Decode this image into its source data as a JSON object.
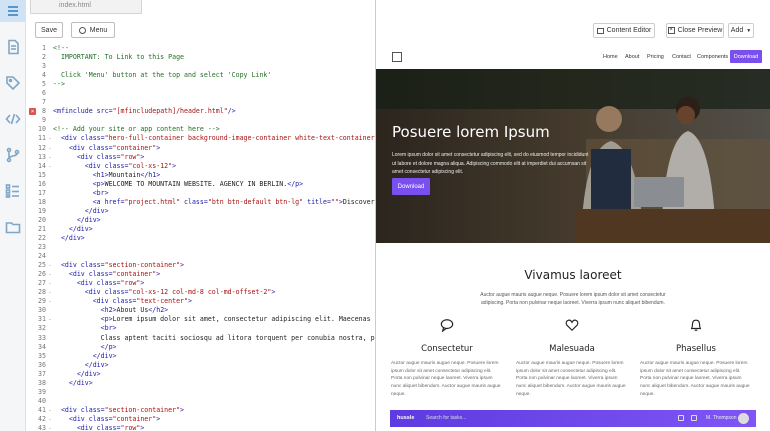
{
  "editor": {
    "file_tab": "index.html",
    "save_label": "Save",
    "menu_label": "Menu",
    "lines": [
      {
        "n": "1",
        "fold": "",
        "err": false,
        "parts": [
          [
            "c-com",
            "<!--"
          ]
        ]
      },
      {
        "n": "2",
        "fold": "",
        "err": false,
        "parts": [
          [
            "c-com",
            "  IMPORTANT: To Link to this Page"
          ]
        ]
      },
      {
        "n": "3",
        "fold": "",
        "err": false,
        "parts": [
          [
            "c-com",
            ""
          ]
        ]
      },
      {
        "n": "4",
        "fold": "",
        "err": false,
        "parts": [
          [
            "c-com",
            "  Click 'Menu' button at the top and select 'Copy Link'"
          ]
        ]
      },
      {
        "n": "5",
        "fold": "",
        "err": false,
        "parts": [
          [
            "c-com",
            "-->"
          ]
        ]
      },
      {
        "n": "6",
        "fold": "",
        "err": false,
        "parts": []
      },
      {
        "n": "7",
        "fold": "",
        "err": false,
        "parts": []
      },
      {
        "n": "8",
        "fold": "",
        "err": true,
        "parts": [
          [
            "c-tag",
            "<mfinclude "
          ],
          [
            "c-tag",
            "src="
          ],
          [
            "c-str",
            "\"[mfincludepath]/header.html\""
          ],
          [
            "c-tag",
            "/>"
          ]
        ]
      },
      {
        "n": "9",
        "fold": "",
        "err": false,
        "parts": []
      },
      {
        "n": "10",
        "fold": "",
        "err": false,
        "parts": [
          [
            "c-com",
            "<!-- Add your site or app content here -->"
          ]
        ]
      },
      {
        "n": "11",
        "fold": "-",
        "err": false,
        "parts": [
          [
            "c-tag",
            "  <div class="
          ],
          [
            "c-str",
            "\"hero-full-container background-image-container white-text-container\""
          ],
          [
            "c-tag",
            ">"
          ]
        ]
      },
      {
        "n": "12",
        "fold": "-",
        "err": false,
        "parts": [
          [
            "c-tag",
            "    <div class="
          ],
          [
            "c-str",
            "\"container\""
          ],
          [
            "c-tag",
            ">"
          ]
        ]
      },
      {
        "n": "13",
        "fold": "-",
        "err": false,
        "parts": [
          [
            "c-tag",
            "      <div class="
          ],
          [
            "c-str",
            "\"row\""
          ],
          [
            "c-tag",
            ">"
          ]
        ]
      },
      {
        "n": "14",
        "fold": "-",
        "err": false,
        "parts": [
          [
            "c-tag",
            "        <div class="
          ],
          [
            "c-str",
            "\"col-xs-12\""
          ],
          [
            "c-tag",
            ">"
          ]
        ]
      },
      {
        "n": "15",
        "fold": "",
        "err": false,
        "parts": [
          [
            "c-tag",
            "          <h1>"
          ],
          [
            "c-txt",
            "Mountain"
          ],
          [
            "c-tag",
            "</h1>"
          ]
        ]
      },
      {
        "n": "16",
        "fold": "",
        "err": false,
        "parts": [
          [
            "c-tag",
            "          <p>"
          ],
          [
            "c-txt",
            "WELCOME TO MOUNTAIN WEBSITE. AGENCY IN BERLIN."
          ],
          [
            "c-tag",
            "</p>"
          ]
        ]
      },
      {
        "n": "17",
        "fold": "",
        "err": false,
        "parts": [
          [
            "c-tag",
            "          <br>"
          ]
        ]
      },
      {
        "n": "18",
        "fold": "",
        "err": false,
        "parts": [
          [
            "c-tag",
            "          <a href="
          ],
          [
            "c-str",
            "\"project.html\""
          ],
          [
            "c-tag",
            " class="
          ],
          [
            "c-str",
            "\"btn btn-default btn-lg\""
          ],
          [
            "c-tag",
            " title="
          ],
          [
            "c-str",
            "\"\""
          ],
          [
            "c-tag",
            ">"
          ],
          [
            "c-txt",
            "Discover"
          ]
        ]
      },
      {
        "n": "19",
        "fold": "",
        "err": false,
        "parts": [
          [
            "c-tag",
            "        </div>"
          ]
        ]
      },
      {
        "n": "20",
        "fold": "",
        "err": false,
        "parts": [
          [
            "c-tag",
            "      </div>"
          ]
        ]
      },
      {
        "n": "21",
        "fold": "",
        "err": false,
        "parts": [
          [
            "c-tag",
            "    </div>"
          ]
        ]
      },
      {
        "n": "22",
        "fold": "",
        "err": false,
        "parts": [
          [
            "c-tag",
            "  </div>"
          ]
        ]
      },
      {
        "n": "23",
        "fold": "",
        "err": false,
        "parts": []
      },
      {
        "n": "24",
        "fold": "",
        "err": false,
        "parts": []
      },
      {
        "n": "25",
        "fold": "-",
        "err": false,
        "parts": [
          [
            "c-tag",
            "  <div class="
          ],
          [
            "c-str",
            "\"section-container\""
          ],
          [
            "c-tag",
            ">"
          ]
        ]
      },
      {
        "n": "26",
        "fold": "-",
        "err": false,
        "parts": [
          [
            "c-tag",
            "    <div class="
          ],
          [
            "c-str",
            "\"container\""
          ],
          [
            "c-tag",
            ">"
          ]
        ]
      },
      {
        "n": "27",
        "fold": "-",
        "err": false,
        "parts": [
          [
            "c-tag",
            "      <div class="
          ],
          [
            "c-str",
            "\"row\""
          ],
          [
            "c-tag",
            ">"
          ]
        ]
      },
      {
        "n": "28",
        "fold": "-",
        "err": false,
        "parts": [
          [
            "c-tag",
            "        <div class="
          ],
          [
            "c-str",
            "\"col-xs-12 col-md-8 col-md-offset-2\""
          ],
          [
            "c-tag",
            ">"
          ]
        ]
      },
      {
        "n": "29",
        "fold": "-",
        "err": false,
        "parts": [
          [
            "c-tag",
            "          <div class="
          ],
          [
            "c-str",
            "\"text-center\""
          ],
          [
            "c-tag",
            ">"
          ]
        ]
      },
      {
        "n": "30",
        "fold": "",
        "err": false,
        "parts": [
          [
            "c-tag",
            "            <h2>"
          ],
          [
            "c-txt",
            "About Us"
          ],
          [
            "c-tag",
            "</h2>"
          ]
        ]
      },
      {
        "n": "31",
        "fold": "-",
        "err": false,
        "parts": [
          [
            "c-tag",
            "            <p>"
          ],
          [
            "c-txt",
            "Lorem ipsum dolor sit amet, consectetur adipiscing elit. Maecenas luctus"
          ]
        ]
      },
      {
        "n": "32",
        "fold": "",
        "err": false,
        "parts": [
          [
            "c-tag",
            "            <br>"
          ]
        ]
      },
      {
        "n": "33",
        "fold": "",
        "err": false,
        "parts": [
          [
            "c-txt",
            "            Class aptent taciti sociosqu ad litora torquent per conubia nostra, per inc"
          ]
        ]
      },
      {
        "n": "34",
        "fold": "",
        "err": false,
        "parts": [
          [
            "c-tag",
            "            </p>"
          ]
        ]
      },
      {
        "n": "35",
        "fold": "",
        "err": false,
        "parts": [
          [
            "c-tag",
            "          </div>"
          ]
        ]
      },
      {
        "n": "36",
        "fold": "",
        "err": false,
        "parts": [
          [
            "c-tag",
            "        </div>"
          ]
        ]
      },
      {
        "n": "37",
        "fold": "",
        "err": false,
        "parts": [
          [
            "c-tag",
            "      </div>"
          ]
        ]
      },
      {
        "n": "38",
        "fold": "",
        "err": false,
        "parts": [
          [
            "c-tag",
            "    </div>"
          ]
        ]
      },
      {
        "n": "39",
        "fold": "",
        "err": false,
        "parts": []
      },
      {
        "n": "40",
        "fold": "",
        "err": false,
        "parts": []
      },
      {
        "n": "41",
        "fold": "-",
        "err": false,
        "parts": [
          [
            "c-tag",
            "  <div class="
          ],
          [
            "c-str",
            "\"section-container\""
          ],
          [
            "c-tag",
            ">"
          ]
        ]
      },
      {
        "n": "42",
        "fold": "-",
        "err": false,
        "parts": [
          [
            "c-tag",
            "    <div class="
          ],
          [
            "c-str",
            "\"container\""
          ],
          [
            "c-tag",
            ">"
          ]
        ]
      },
      {
        "n": "43",
        "fold": "-",
        "err": false,
        "parts": [
          [
            "c-tag",
            "      <div class="
          ],
          [
            "c-str",
            "\"row\""
          ],
          [
            "c-tag",
            ">"
          ]
        ]
      },
      {
        "n": "44",
        "fold": "-",
        "err": false,
        "parts": [
          [
            "c-tag",
            "        <div class="
          ],
          [
            "c-str",
            "\"col-xs-12\""
          ],
          [
            "c-tag",
            ">"
          ]
        ]
      }
    ]
  },
  "preview": {
    "content_editor_label": "Content Editor",
    "close_preview_label": "Close Preview",
    "add_label": "Add",
    "nav": {
      "links": [
        "Home",
        "About",
        "Pricing",
        "Contact",
        "Components"
      ],
      "download": "Download"
    },
    "hero": {
      "title": "Posuere lorem Ipsum",
      "text": "Lorem ipsum dolor sit amet consectetur adipiscing elit, sed do eiusmod tempor incididunt ut labore et dolore magna aliqua. Adipiscing commodo elit at imperdiet dui accumsan sit amet consectetur adipiscing elit.",
      "button": "Download"
    },
    "section": {
      "title": "Vivamus laoreet",
      "subtitle": "Auctor augue mauris augue neque. Posuere lorem ipsum dolor sit amet consectetur adipiscing. Porta non pulvinar neque laoreet. Viverra ipsum nunc aliquet bibendum."
    },
    "features": [
      {
        "icon": "chat-bubble-icon",
        "title": "Consectetur",
        "text": "Auctor augue mauris augue neque. Posuere lorem ipsum dolor sit amet consectetur adipiscing elit. Porta non pulvinar neque laoreet. Viverra ipsum nunc aliquet bibendum. Auctor augue mauris augue neque."
      },
      {
        "icon": "heart-icon",
        "title": "Malesuada",
        "text": "Auctor augue mauris augue neque. Posuere lorem ipsum dolor sit amet consectetur adipiscing elit. Porta non pulvinar neque laoreet. Viverra ipsum nunc aliquet bibendum. Auctor augue mauris augue neque."
      },
      {
        "icon": "bell-icon",
        "title": "Phasellus",
        "text": "Auctor augue mauris augue neque. Posuere lorem ipsum dolor sit amet consectetur adipiscing elit. Porta non pulvinar neque laoreet. Viverra ipsum nunc aliquet bibendum. Auctor augue mauris augue neque."
      }
    ],
    "bottom_bar": {
      "logo": "hussle",
      "search": "Search for tasks...",
      "user": "M. Thompson"
    }
  },
  "colors": {
    "accent": "#7a4ff0",
    "rail_bg": "#f4f6f8",
    "rail_active": "#cfe3f5"
  }
}
